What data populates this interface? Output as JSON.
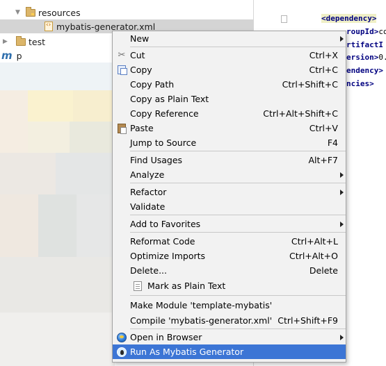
{
  "tree": {
    "resources_label": "resources",
    "generator_file_label": "mybatis-generator.xml",
    "test_label": "test",
    "partial_label": "p"
  },
  "editor": {
    "lines": [
      {
        "tag": "<dependency>",
        "rest": ""
      },
      {
        "tag": "roupId>",
        "rest": "co"
      },
      {
        "tag": "rtifactI",
        "rest": ""
      },
      {
        "tag": "ersion>",
        "rest": "0."
      },
      {
        "tag": "endency>",
        "rest": ""
      },
      {
        "tag": "ncies>",
        "rest": ""
      }
    ]
  },
  "context_menu": {
    "items": [
      {
        "key": "new",
        "label": "New",
        "shortcut": "",
        "icon": "",
        "submenu": true
      },
      {
        "key": "cut",
        "label": "Cut",
        "mnemonic": "t",
        "shortcut": "Ctrl+X",
        "icon": "scissors-icon"
      },
      {
        "key": "copy",
        "label": "Copy",
        "mnemonic": "C",
        "shortcut": "Ctrl+C",
        "icon": "copy-icon"
      },
      {
        "key": "copy_path",
        "label": "Copy Path",
        "shortcut": "Ctrl+Shift+C",
        "icon": ""
      },
      {
        "key": "copy_plain",
        "label": "Copy as Plain Text",
        "shortcut": "",
        "icon": ""
      },
      {
        "key": "copy_ref",
        "label": "Copy Reference",
        "shortcut": "Ctrl+Alt+Shift+C",
        "icon": ""
      },
      {
        "key": "paste",
        "label": "Paste",
        "mnemonic": "P",
        "shortcut": "Ctrl+V",
        "icon": "paste-icon"
      },
      {
        "key": "jump",
        "label": "Jump to Source",
        "shortcut": "F4",
        "icon": ""
      },
      {
        "key": "find_usages",
        "label": "Find Usages",
        "shortcut": "Alt+F7",
        "icon": ""
      },
      {
        "key": "analyze",
        "label": "Analyze",
        "shortcut": "",
        "submenu": true
      },
      {
        "key": "refactor",
        "label": "Refactor",
        "shortcut": "",
        "submenu": true
      },
      {
        "key": "validate",
        "label": "Validate",
        "shortcut": ""
      },
      {
        "key": "favorites",
        "label": "Add to Favorites",
        "shortcut": "",
        "submenu": true
      },
      {
        "key": "reformat",
        "label": "Reformat Code",
        "shortcut": "Ctrl+Alt+L"
      },
      {
        "key": "optimize",
        "label": "Optimize Imports",
        "shortcut": "Ctrl+Alt+O"
      },
      {
        "key": "delete",
        "label": "Delete...",
        "shortcut": "Delete"
      },
      {
        "key": "mark_plain",
        "label": "Mark as Plain Text",
        "shortcut": "",
        "icon": "mark-text-icon"
      },
      {
        "key": "make_module",
        "label": "Make Module 'template-mybatis'",
        "shortcut": ""
      },
      {
        "key": "compile",
        "label": "Compile 'mybatis-generator.xml'",
        "shortcut": "Ctrl+Shift+F9"
      },
      {
        "key": "open_browser",
        "label": "Open in Browser",
        "shortcut": "",
        "submenu": true,
        "icon": "globe-icon"
      },
      {
        "key": "run_mybatis",
        "label": "Run As Mybatis Generator",
        "shortcut": "",
        "icon": "mybatis-icon",
        "highlighted": true
      }
    ]
  },
  "colors": {
    "menu_background": "#f2f2f2",
    "highlight": "#3c75d5",
    "tree_selection": "#d4d4d4",
    "xml_tag": "#000080"
  }
}
